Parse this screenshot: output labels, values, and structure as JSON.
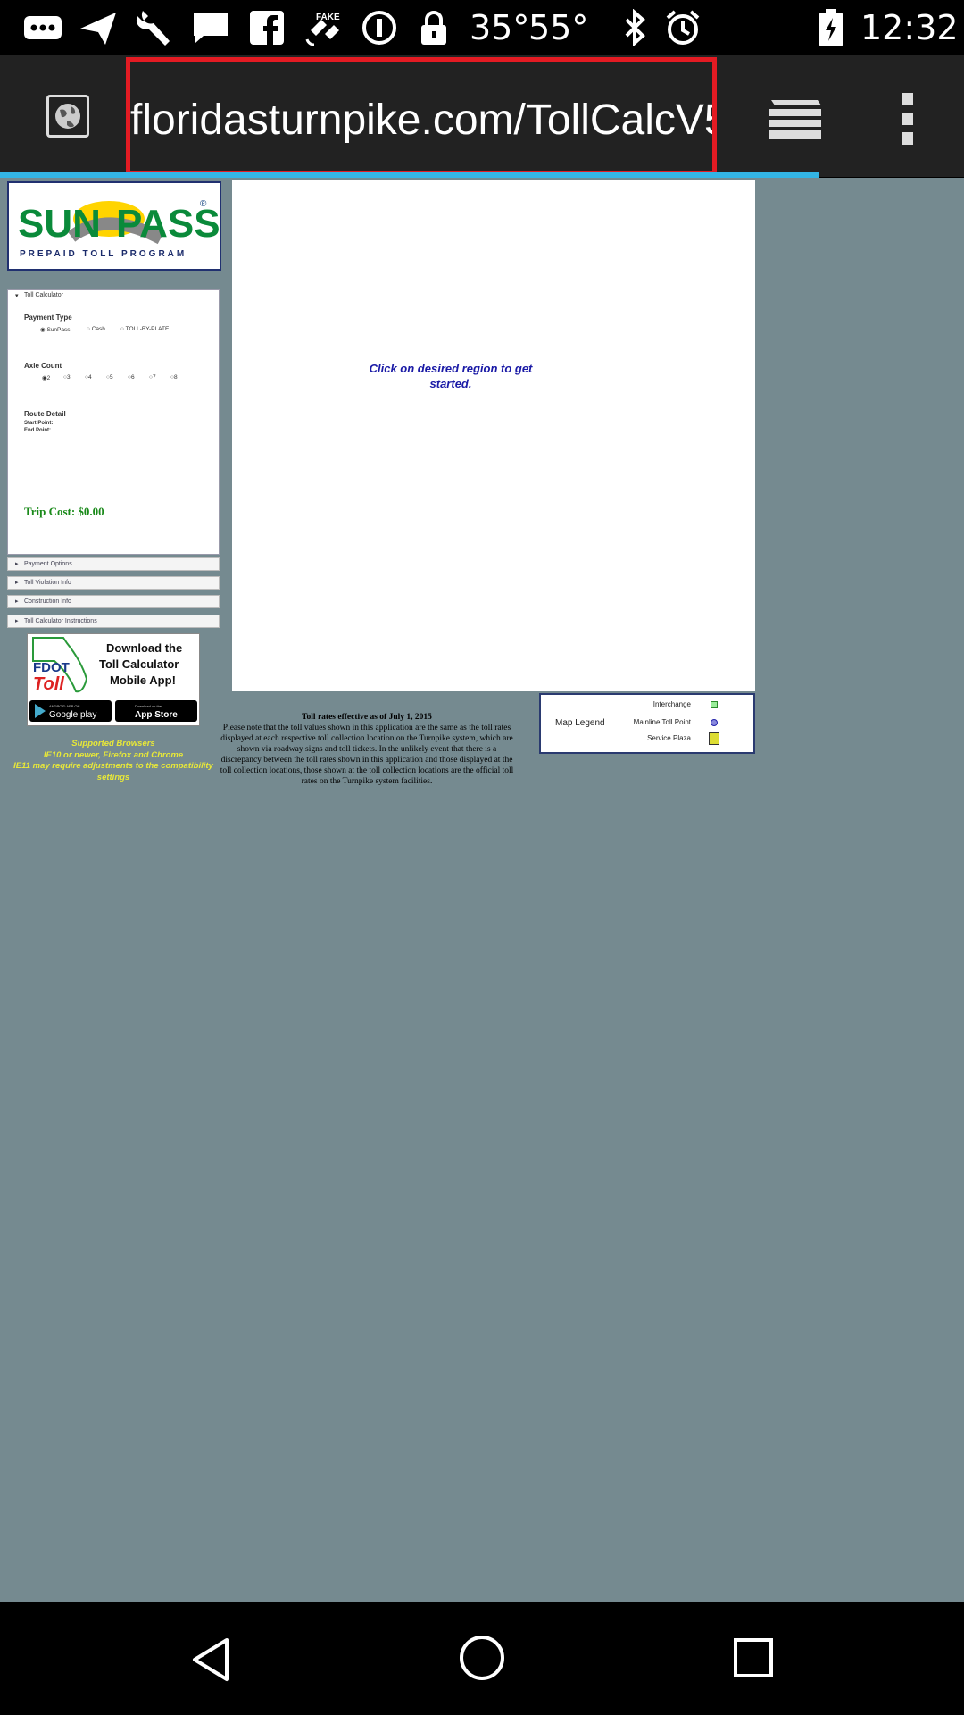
{
  "status_bar": {
    "temp1": "35°",
    "temp2": "55°",
    "time": "12:32",
    "icons": [
      "more-icon",
      "send-icon",
      "wrench-icon",
      "message-icon",
      "facebook-icon",
      "fake-gps-icon",
      "info-icon",
      "lock-icon",
      "bluetooth-icon",
      "alarm-icon",
      "battery-icon"
    ]
  },
  "browser": {
    "url": "floridasturnpike.com/TollCalcV5",
    "accent": "#33b5e5",
    "highlight": "#e31b23"
  },
  "page": {
    "logo": {
      "brand": "SUNPASS",
      "tagline": "PREPAID TOLL PROGRAM",
      "reg": "®"
    },
    "calculator": {
      "title": "Toll Calculator",
      "payment_type_label": "Payment Type",
      "payment_options": [
        "SunPass",
        "Cash",
        "TOLL-BY-PLATE"
      ],
      "axle_count_label": "Axle Count",
      "axle_options": [
        "2",
        "3",
        "4",
        "5",
        "6",
        "7",
        "8"
      ],
      "route_detail_label": "Route Detail",
      "start_point_label": "Start Point:",
      "end_point_label": "End Point:",
      "trip_cost": "Trip Cost: $0.00"
    },
    "sections": [
      "Payment Options",
      "Toll Violation Info",
      "Construction Info",
      "Toll Calculator Instructions"
    ],
    "app_banner": {
      "fdot": "FDOT",
      "toll": "Toll",
      "headline": "Download the Toll Calculator Mobile App!",
      "google_play": "Google play",
      "app_store": "App Store",
      "google_small": "ANDROID APP ON",
      "apple_small": "Download on the"
    },
    "browsers_note": {
      "title": "Supported Browsers",
      "line1": "IE10 or newer, Firefox and Chrome",
      "line2": "IE11 may require adjustments to the compatibility settings"
    },
    "map_prompt": "Click on desired region to get started.",
    "rates": {
      "title": "Toll rates effective as of July 1, 2015",
      "body": "Please note that the toll values shown in this application are the same as the toll rates displayed at each respective toll collection location on the Turnpike system, which are shown via roadway signs and toll tickets. In the unlikely event that there is a discrepancy between the toll rates shown in this application and those displayed at the toll collection locations, those shown at the toll collection locations are the official toll rates on the Turnpike system facilities."
    },
    "legend": {
      "title": "Map Legend",
      "items": [
        "Interchange",
        "Mainline Toll Point",
        "Service Plaza"
      ]
    }
  },
  "nav": {
    "icons": [
      "back-icon",
      "home-icon",
      "recents-icon"
    ]
  }
}
